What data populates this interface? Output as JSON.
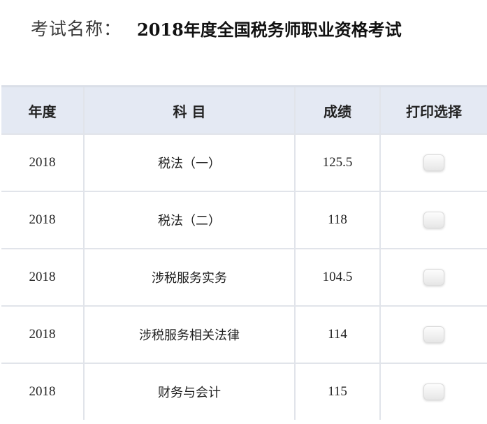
{
  "exam": {
    "label": "考试名称：",
    "name": "2018年度全国税务师职业资格考试"
  },
  "table": {
    "headers": {
      "year": "年度",
      "subject": "科 目",
      "score": "成绩",
      "print_select": "打印选择"
    },
    "rows": [
      {
        "year": "2018",
        "subject": "税法（一）",
        "score": "125.5",
        "selected": false
      },
      {
        "year": "2018",
        "subject": "税法（二）",
        "score": "118",
        "selected": false
      },
      {
        "year": "2018",
        "subject": "涉税服务实务",
        "score": "104.5",
        "selected": false
      },
      {
        "year": "2018",
        "subject": "涉税服务相关法律",
        "score": "114",
        "selected": false
      },
      {
        "year": "2018",
        "subject": "财务与会计",
        "score": "115",
        "selected": false
      }
    ]
  },
  "colors": {
    "header_background": "#e4e9f3",
    "border": "#e1e4ea"
  }
}
